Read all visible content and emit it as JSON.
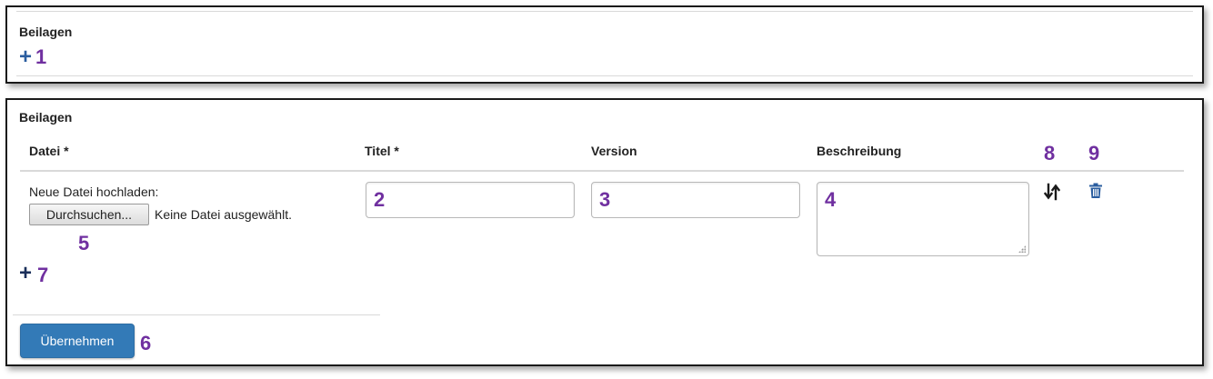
{
  "panel1": {
    "heading": "Beilagen",
    "marker": "1"
  },
  "panel2": {
    "heading": "Beilagen",
    "columns": {
      "file": "Datei *",
      "title": "Titel *",
      "version": "Version",
      "description": "Beschreibung"
    },
    "upload_label": "Neue Datei hochladen:",
    "browse_label": "Durchsuchen...",
    "no_file_text": "Keine Datei ausgewählt.",
    "submit_label": "Übernehmen",
    "markers": {
      "title": "2",
      "version": "3",
      "description": "4",
      "browse": "5",
      "submit": "6",
      "add": "7",
      "sort": "8",
      "delete": "9"
    }
  },
  "colors": {
    "accent": "#337ab7",
    "marker": "#7030a0"
  }
}
